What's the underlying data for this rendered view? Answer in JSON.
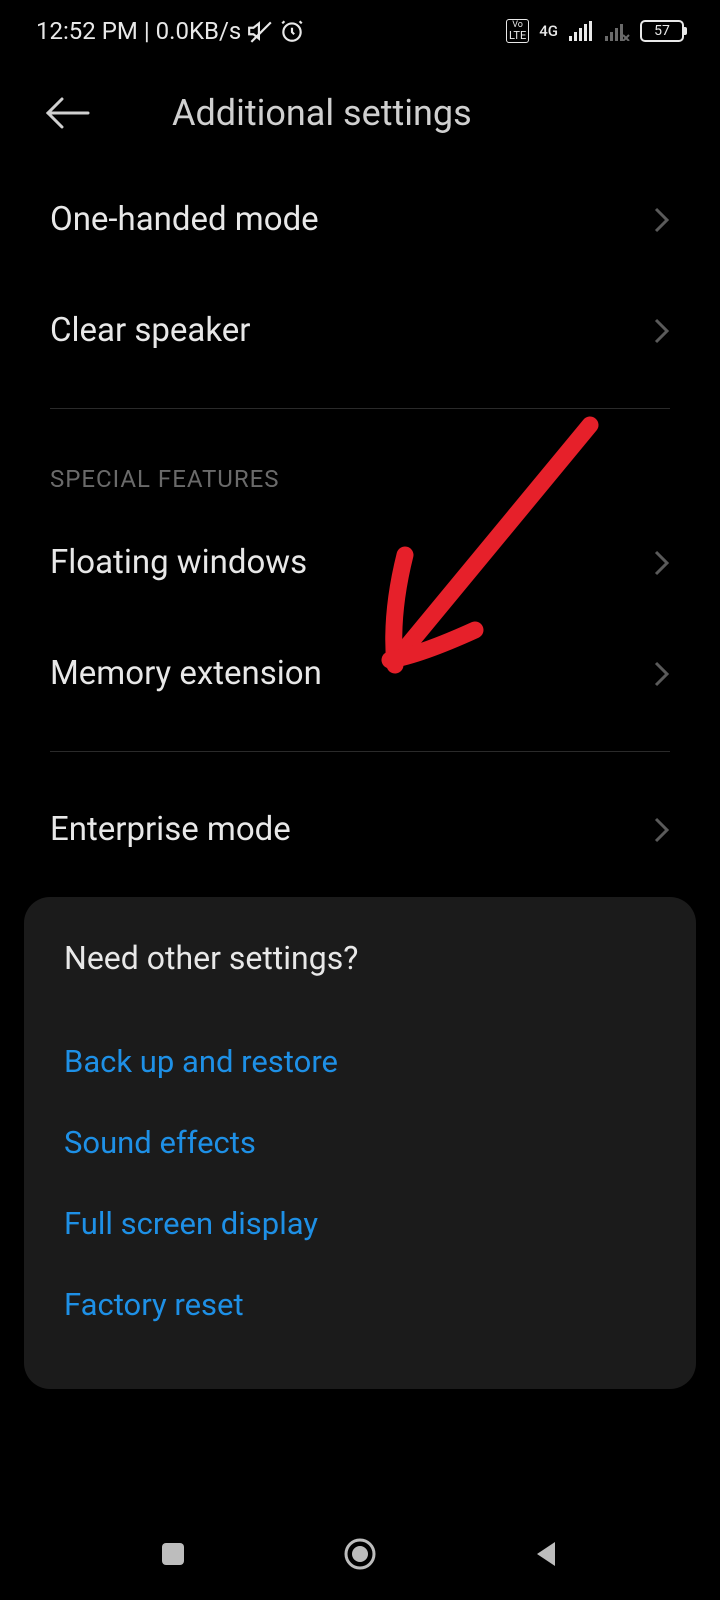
{
  "status": {
    "time": "12:52 PM",
    "separator": "|",
    "netspeed": "0.0KB/s",
    "volte": "Vo LTE",
    "net_label": "4G",
    "battery": "57"
  },
  "header": {
    "title": "Additional settings"
  },
  "rows": {
    "one_handed": "One-handed mode",
    "clear_speaker": "Clear speaker",
    "floating_windows": "Floating windows",
    "memory_extension": "Memory extension",
    "enterprise_mode": "Enterprise mode"
  },
  "section": {
    "special_features": "SPECIAL FEATURES"
  },
  "card": {
    "title": "Need other settings?",
    "links": {
      "backup": "Back up and restore",
      "sound": "Sound effects",
      "fullscreen": "Full screen display",
      "factory": "Factory reset"
    }
  }
}
